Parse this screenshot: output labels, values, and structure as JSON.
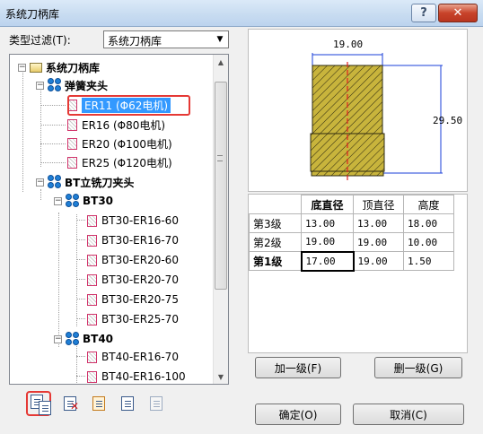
{
  "window": {
    "title": "系统刀柄库",
    "help_label": "?",
    "close_label": "✕"
  },
  "filter": {
    "label": "类型过滤(T):",
    "value": "系统刀柄库"
  },
  "tree": {
    "root": "系统刀柄库",
    "group1": "弹簧夹头",
    "g1_items": [
      "ER11 (Φ62电机)",
      "ER16 (Φ80电机)",
      "ER20 (Φ100电机)",
      "ER25 (Φ120电机)"
    ],
    "group2": "BT立铣刀夹头",
    "bt30": "BT30",
    "bt30_items": [
      "BT30-ER16-60",
      "BT30-ER16-70",
      "BT30-ER20-60",
      "BT30-ER20-70",
      "BT30-ER20-75",
      "BT30-ER25-70"
    ],
    "bt40": "BT40",
    "bt40_items": [
      "BT40-ER16-70",
      "BT40-ER16-100"
    ]
  },
  "preview": {
    "top_dim": "19.00",
    "side_dim": "29.50"
  },
  "params": {
    "headers": [
      "底直径",
      "顶直径",
      "高度"
    ],
    "rows": [
      {
        "level": "第3级",
        "bottom": "13.00",
        "top": "13.00",
        "height": "18.00"
      },
      {
        "level": "第2级",
        "bottom": "19.00",
        "top": "19.00",
        "height": "10.00"
      },
      {
        "level": "第1级",
        "bottom": "17.00",
        "top": "19.00",
        "height": "1.50"
      }
    ]
  },
  "buttons": {
    "add_level": "加一级(F)",
    "del_level": "删一级(G)",
    "ok": "确定(O)",
    "cancel": "取消(C)"
  },
  "colors": {
    "accent_red": "#e53935",
    "selection": "#3399ff",
    "hatch": "#c8b43c"
  }
}
